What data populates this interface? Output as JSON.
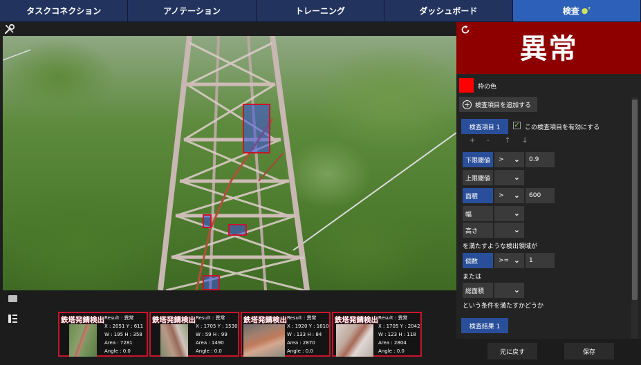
{
  "tabs": [
    {
      "label": "タスクコネクション"
    },
    {
      "label": "アノテーション"
    },
    {
      "label": "トレーニング"
    },
    {
      "label": "ダッシュボード"
    },
    {
      "label": "検査"
    }
  ],
  "active_tab": 4,
  "active_tab_indicator": "?",
  "panel": {
    "result": "異常",
    "frame_color_label": "枠の色",
    "frame_color": "#ff0000",
    "add_item_label": "検査項目を追加する",
    "item_button": "検査項目 1",
    "enable_label": "この検査項目を有効にする",
    "enabled": true,
    "mini_buttons": [
      "+",
      "-",
      "↑",
      "↓"
    ],
    "rows": [
      {
        "label": "下限閾値",
        "op": ">",
        "value": "0.9",
        "active": true
      },
      {
        "label": "上限閾値",
        "op": "",
        "value": "",
        "active": false
      },
      {
        "label": "面積",
        "op": ">",
        "value": "600",
        "active": true
      },
      {
        "label": "幅",
        "op": "",
        "value": "",
        "active": false
      },
      {
        "label": "高さ",
        "op": "",
        "value": "",
        "active": false
      }
    ],
    "condition_text": "を満たすような検出領域が",
    "count_row": {
      "label": "個数",
      "op": ">=",
      "value": "1"
    },
    "or_text": "または",
    "total_area_label": "総面積",
    "end_text": "という条件を満たすかどうか",
    "result_button": "検査結果 1",
    "reset_button": "元に戻す",
    "save_button": "保存"
  },
  "detections": [
    {
      "title": "鉄塔発錆検出",
      "result": "Result : 異常",
      "xy": "X : 2051 Y : 611",
      "wh": "W : 195 H : 358",
      "area": "Area : 7281",
      "angle": "Angle : 0.0"
    },
    {
      "title": "鉄塔発錆検出",
      "result": "Result : 異常",
      "xy": "X : 1705 Y : 1530",
      "wh": "W : 59 H : 99",
      "area": "Area : 1490",
      "angle": "Angle : 0.0"
    },
    {
      "title": "鉄塔発錆検出",
      "result": "Result : 異常",
      "xy": "X : 1920 Y : 1610",
      "wh": "W : 133 H : 84",
      "area": "Area : 2870",
      "angle": "Angle : 0.0"
    },
    {
      "title": "鉄塔発錆検出",
      "result": "Result : 異常",
      "xy": "X : 1705 Y : 2042",
      "wh": "W : 123 H : 118",
      "area": "Area : 2804",
      "angle": "Angle : 0.0"
    }
  ],
  "colors": {
    "tab_bg": "#22345e",
    "tab_active": "#2d61b9",
    "result_bg": "#8e0000",
    "accent_blue": "#2a4f9a",
    "detection_border": "#c8152a"
  },
  "icons": [
    "wrench-icon",
    "refresh-icon",
    "image-icon",
    "list-icon",
    "plus-circle-icon",
    "chevron-down-icon",
    "check-icon",
    "bulb-icon"
  ]
}
